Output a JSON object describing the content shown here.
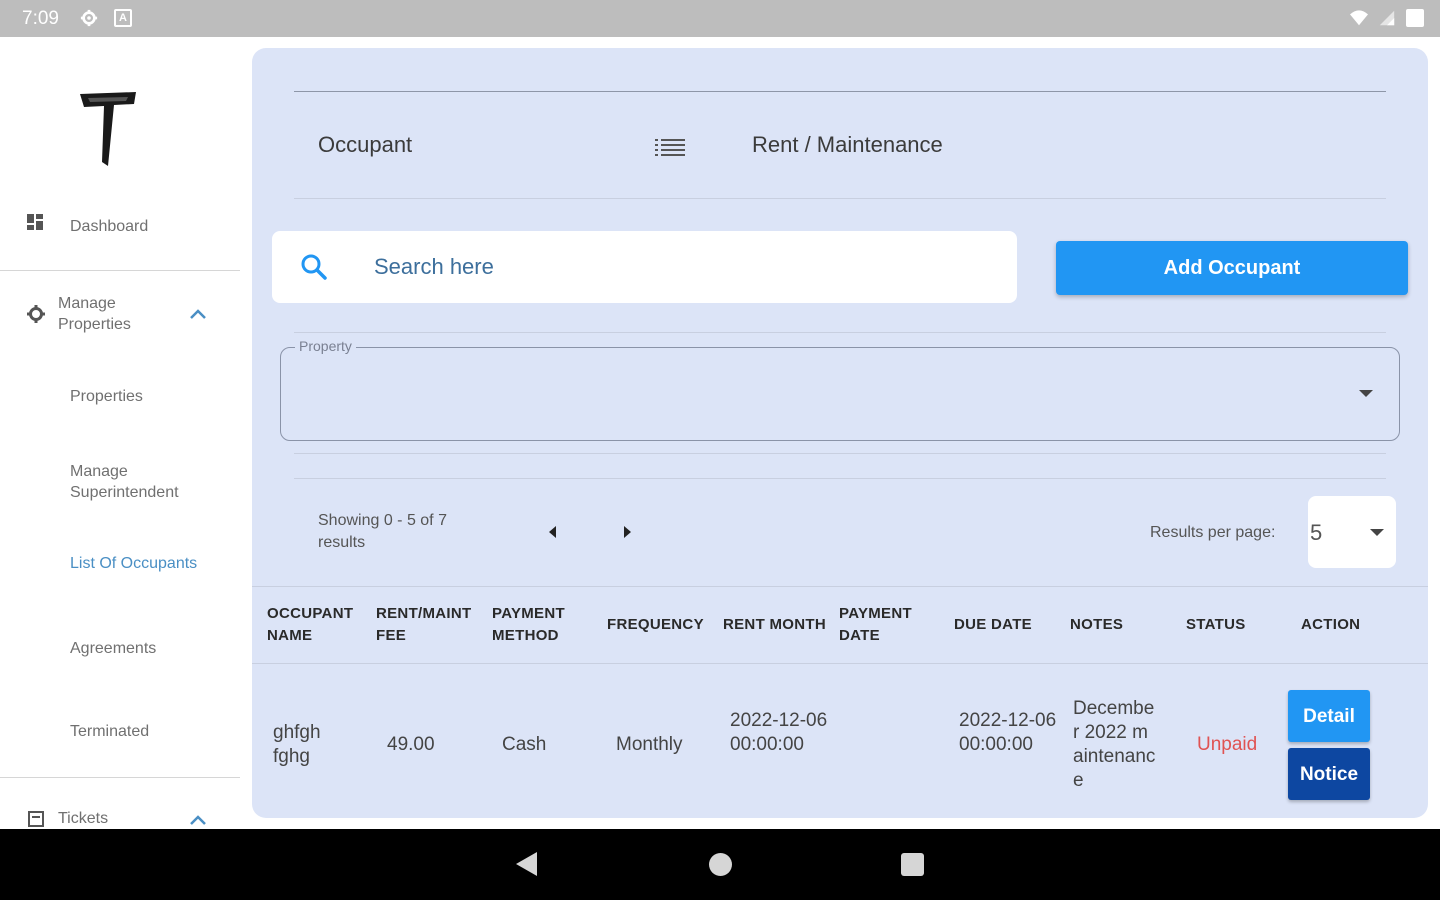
{
  "status_bar": {
    "time": "7:09"
  },
  "sidebar": {
    "items": [
      {
        "label": "Dashboard"
      },
      {
        "label": "Manage Properties"
      },
      {
        "label": "Properties"
      },
      {
        "label": "Manage Superintendent"
      },
      {
        "label": "List Of Occupants"
      },
      {
        "label": "Agreements"
      },
      {
        "label": "Terminated"
      },
      {
        "label": "Tickets"
      }
    ],
    "colors": {
      "active": "#4a8fc4",
      "text": "#707070"
    }
  },
  "main": {
    "tabs": [
      {
        "label": "Occupant"
      },
      {
        "label": "Rent / Maintenance"
      }
    ],
    "search": {
      "placeholder": "Search here"
    },
    "add_button": "Add Occupant",
    "property_field": {
      "label": "Property",
      "value": ""
    },
    "pagination": {
      "showing": "Showing 0 - 5 of 7 results",
      "results_per_page_label": "Results per page:",
      "results_per_page": "5"
    },
    "table": {
      "columns": [
        "OCCUPANT NAME",
        "RENT/MAINT FEE",
        "PAYMENT METHOD",
        "FREQUENCY",
        "RENT MONTH",
        "PAYMENT DATE",
        "DUE DATE",
        "NOTES",
        "STATUS",
        "ACTION"
      ],
      "rows": [
        {
          "occupant_name": "ghfgh fghg",
          "fee": "49.00",
          "payment_method": "Cash",
          "frequency": "Monthly",
          "rent_month": "2022-12-06 00:00:00",
          "payment_date": "",
          "due_date": "2022-12-06 00:00:00",
          "notes": "December 2022 maintenance",
          "status": "Unpaid",
          "actions": {
            "detail": "Detail",
            "notice": "Notice"
          }
        }
      ]
    },
    "colors": {
      "panel_bg": "#dce4f7",
      "primary": "#2196f3",
      "dark_button": "#0d47a1",
      "unpaid": "#e05353"
    }
  }
}
